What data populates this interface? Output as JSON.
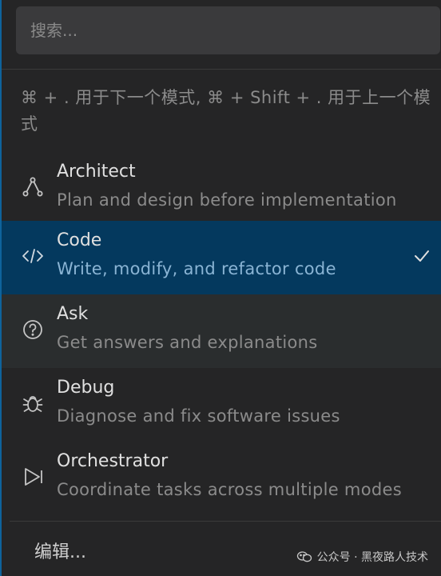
{
  "search": {
    "placeholder": "搜索..."
  },
  "hint": "⌘ + . 用于下一个模式, ⌘ + Shift + . 用于上一个模式",
  "modes": [
    {
      "title": "Architect",
      "description": "Plan and design before implementation",
      "icon": "architect-nodes-icon"
    },
    {
      "title": "Code",
      "description": "Write, modify, and refactor code",
      "icon": "code-brackets-icon",
      "selected": true
    },
    {
      "title": "Ask",
      "description": "Get answers and explanations",
      "icon": "question-circle-icon"
    },
    {
      "title": "Debug",
      "description": "Diagnose and fix software issues",
      "icon": "bug-icon"
    },
    {
      "title": "Orchestrator",
      "description": "Coordinate tasks across multiple modes",
      "icon": "play-forward-icon"
    }
  ],
  "footer": {
    "edit_label": "编辑..."
  },
  "watermark": {
    "text": "公众号 · 黑夜路人技术"
  },
  "colors": {
    "background": "#252526",
    "selected_row": "#04395e",
    "hover_row": "#2a2d2e",
    "accent_border": "#0e639c"
  }
}
